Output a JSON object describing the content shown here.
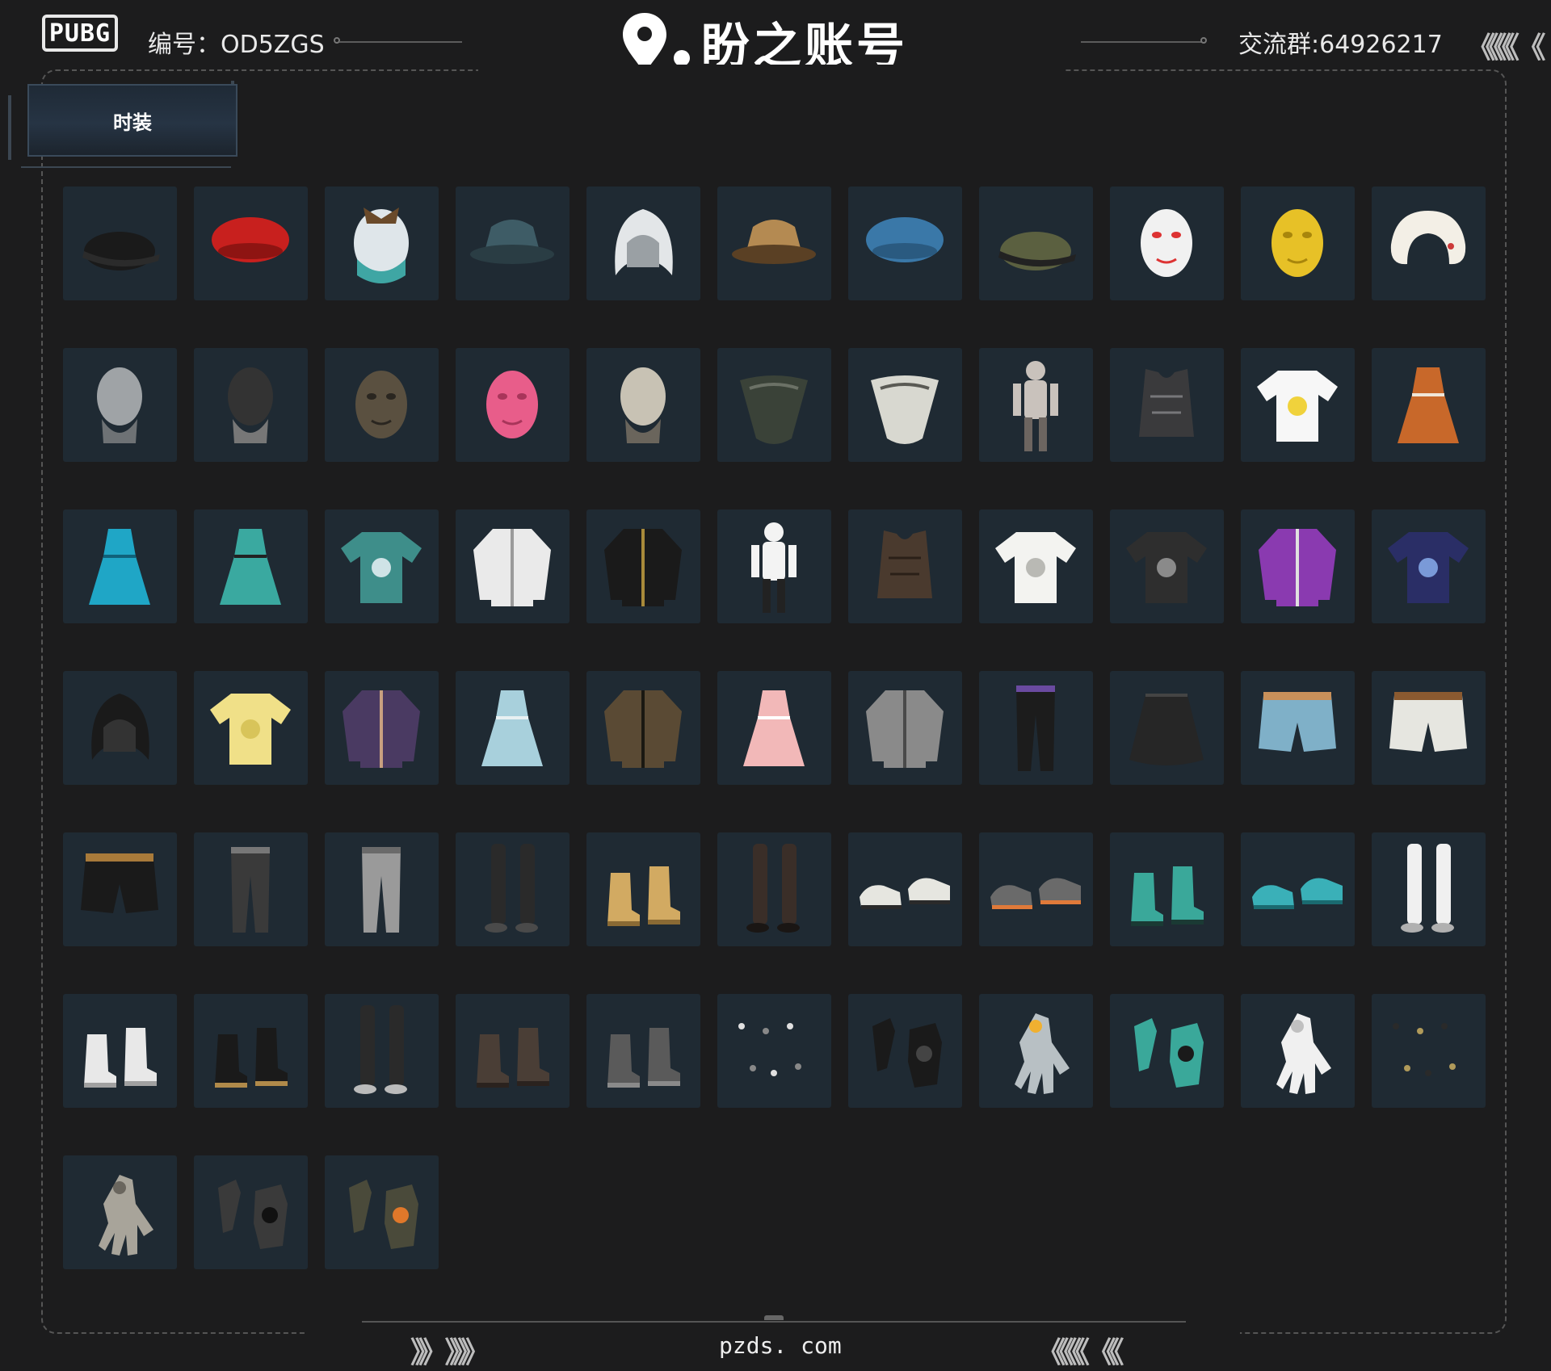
{
  "header": {
    "logo_text": "PUBG",
    "account_label": "编号：OD5ZGS",
    "brand_name": "盼之账号",
    "group_label": "交流群:64926217",
    "right_chevrons": "《《《《 《"
  },
  "tab": {
    "label": "时装"
  },
  "items": [
    {
      "icon": "black-cap-icon",
      "kind": "cap",
      "c1": "#1a1a1a",
      "c2": "#2b2b2b"
    },
    {
      "icon": "red-beret-icon",
      "kind": "beret",
      "c1": "#c8201e",
      "c2": "#8e1412"
    },
    {
      "icon": "fluffy-hat-icon",
      "kind": "fluffy",
      "c1": "#dfe6ea",
      "c2": "#3fa6a4"
    },
    {
      "icon": "bucket-hat-icon",
      "kind": "bucket",
      "c1": "#3e5c66",
      "c2": "#2a3d44"
    },
    {
      "icon": "white-hood-hat-icon",
      "kind": "hood",
      "c1": "#e3e6e8",
      "c2": "#9aa0a4"
    },
    {
      "icon": "leopard-bucket-hat-icon",
      "kind": "bucket",
      "c1": "#b48a52",
      "c2": "#5a4024"
    },
    {
      "icon": "blue-plaid-beret-icon",
      "kind": "beret",
      "c1": "#3a78a8",
      "c2": "#2a5a80"
    },
    {
      "icon": "headset-cap-icon",
      "kind": "cap",
      "c1": "#5b6040",
      "c2": "#222"
    },
    {
      "icon": "chicken-mask-icon",
      "kind": "mask",
      "c1": "#f1f1f1",
      "c2": "#d33"
    },
    {
      "icon": "gold-mask-icon",
      "kind": "mask",
      "c1": "#e7c127",
      "c2": "#a8860c"
    },
    {
      "icon": "neck-pillow-icon",
      "kind": "pillow",
      "c1": "#f3efe6",
      "c2": "#cc3a3a"
    },
    {
      "icon": "bald-head-icon",
      "kind": "head",
      "c1": "#9fa3a6",
      "c2": "#6e7275"
    },
    {
      "icon": "tactical-mask-icon",
      "kind": "head",
      "c1": "#333",
      "c2": "#777"
    },
    {
      "icon": "wolf-mask-icon",
      "kind": "mask",
      "c1": "#5a5040",
      "c2": "#2a2620"
    },
    {
      "icon": "pink-dino-mask-icon",
      "kind": "mask",
      "c1": "#e85d8a",
      "c2": "#a8355a"
    },
    {
      "icon": "skull-mask-icon",
      "kind": "head",
      "c1": "#c8c2b4",
      "c2": "#6a655c"
    },
    {
      "icon": "camo-bandana-icon",
      "kind": "bandana",
      "c1": "#3a4238",
      "c2": "#6b7166"
    },
    {
      "icon": "shemagh-bandana-icon",
      "kind": "bandana",
      "c1": "#d8d8d0",
      "c2": "#5a5a54"
    },
    {
      "icon": "assassin-suit-icon",
      "kind": "figure",
      "c1": "#c9c2bc",
      "c2": "#6c6560"
    },
    {
      "icon": "metal-corset-icon",
      "kind": "vest",
      "c1": "#3a3a3c",
      "c2": "#77777a"
    },
    {
      "icon": "yellow-tshirt-icon",
      "kind": "shirt",
      "c1": "#f7f7f7",
      "c2": "#f0d23c"
    },
    {
      "icon": "tiger-dress-icon",
      "kind": "dress",
      "c1": "#c8682a",
      "c2": "#f0e6d8"
    },
    {
      "icon": "blue-dress-icon",
      "kind": "dress",
      "c1": "#1fa6c6",
      "c2": "#10627a"
    },
    {
      "icon": "teal-dress-icon",
      "kind": "dress",
      "c1": "#3aa9a0",
      "c2": "#222"
    },
    {
      "icon": "hawaiian-shirt-icon",
      "kind": "shirt",
      "c1": "#3e8e8a",
      "c2": "#cfe3e6"
    },
    {
      "icon": "white-uniform-icon",
      "kind": "coat",
      "c1": "#eaeaea",
      "c2": "#9a9a9a"
    },
    {
      "icon": "black-gold-jacket-icon",
      "kind": "coat",
      "c1": "#1a1a1a",
      "c2": "#a88a3a"
    },
    {
      "icon": "dalmatian-suit-icon",
      "kind": "figure",
      "c1": "#f3f3f3",
      "c2": "#222"
    },
    {
      "icon": "leather-vest-icon",
      "kind": "vest",
      "c1": "#4a3a2e",
      "c2": "#2a2018"
    },
    {
      "icon": "white-kungfu-shirt-icon",
      "kind": "shirt",
      "c1": "#f3f3f0",
      "c2": "#b9b9b4"
    },
    {
      "icon": "winner-tshirt-icon",
      "kind": "shirt",
      "c1": "#2e2e2e",
      "c2": "#8a8a8a"
    },
    {
      "icon": "purple-jacket-icon",
      "kind": "coat",
      "c1": "#8a3ab0",
      "c2": "#e0e0e0"
    },
    {
      "icon": "anniversary-sweater-icon",
      "kind": "shirt",
      "c1": "#2a2e66",
      "c2": "#7a9ad8"
    },
    {
      "icon": "black-hood-cloak-icon",
      "kind": "hood",
      "c1": "#1a1a1a",
      "c2": "#333"
    },
    {
      "icon": "yellow-sweater-icon",
      "kind": "shirt",
      "c1": "#f0e088",
      "c2": "#d8c45a"
    },
    {
      "icon": "purple-bomber-jacket-icon",
      "kind": "coat",
      "c1": "#4a3a62",
      "c2": "#c8a080"
    },
    {
      "icon": "nurse-outfit-icon",
      "kind": "dress",
      "c1": "#a8d0dc",
      "c2": "#e8f0f2"
    },
    {
      "icon": "leopard-coat-icon",
      "kind": "coat",
      "c1": "#5a4a34",
      "c2": "#1a1812"
    },
    {
      "icon": "pink-hoodie-icon",
      "kind": "dress",
      "c1": "#f2b8b8",
      "c2": "#fff"
    },
    {
      "icon": "grey-shirt-icon",
      "kind": "coat",
      "c1": "#8a8a8a",
      "c2": "#4a4a4a"
    },
    {
      "icon": "black-trousers-icon",
      "kind": "pants",
      "c1": "#1c1c1c",
      "c2": "#6a4aa0"
    },
    {
      "icon": "black-skirt-icon",
      "kind": "skirt",
      "c1": "#262626",
      "c2": "#444"
    },
    {
      "icon": "denim-shorts-icon",
      "kind": "shorts",
      "c1": "#7fb0c8",
      "c2": "#c8905a"
    },
    {
      "icon": "white-shorts-icon",
      "kind": "shorts",
      "c1": "#e6e6e0",
      "c2": "#8a5a30"
    },
    {
      "icon": "leopard-shorts-icon",
      "kind": "shorts",
      "c1": "#1a1a1a",
      "c2": "#a87a3a"
    },
    {
      "icon": "ripped-jeans-icon",
      "kind": "pants",
      "c1": "#3a3a3a",
      "c2": "#777"
    },
    {
      "icon": "grey-joggers-icon",
      "kind": "pants",
      "c1": "#9a9a9a",
      "c2": "#6a6a6a"
    },
    {
      "icon": "black-thigh-boots-icon",
      "kind": "tallboots",
      "c1": "#2a2a2a",
      "c2": "#4a4a4a"
    },
    {
      "icon": "tan-work-boots-icon",
      "kind": "boots",
      "c1": "#d2aa62",
      "c2": "#8a6a34"
    },
    {
      "icon": "brown-tights-icon",
      "kind": "tallboots",
      "c1": "#3a2e28",
      "c2": "#1a1614"
    },
    {
      "icon": "sandals-icon",
      "kind": "shoes",
      "c1": "#e6e6e0",
      "c2": "#2a2a2a"
    },
    {
      "icon": "grey-sneakers-icon",
      "kind": "shoes",
      "c1": "#6a6a6a",
      "c2": "#e07a3a"
    },
    {
      "icon": "teal-combat-boots-icon",
      "kind": "boots",
      "c1": "#3aa89a",
      "c2": "#1a3a34"
    },
    {
      "icon": "teal-clogs-icon",
      "kind": "shoes",
      "c1": "#3ab0b8",
      "c2": "#1a6a70"
    },
    {
      "icon": "white-tall-boots-icon",
      "kind": "tallboots",
      "c1": "#f0f0f0",
      "c2": "#b0b0b0"
    },
    {
      "icon": "white-slouch-boots-icon",
      "kind": "boots",
      "c1": "#e8e8e8",
      "c2": "#a0a0a0"
    },
    {
      "icon": "leopard-sneakers-icon",
      "kind": "boots",
      "c1": "#1a1a1a",
      "c2": "#b08a4a"
    },
    {
      "icon": "fur-boots-icon",
      "kind": "tallboots",
      "c1": "#2a2a2a",
      "c2": "#bbb"
    },
    {
      "icon": "brown-boots-icon",
      "kind": "boots",
      "c1": "#4a3e36",
      "c2": "#2a221e"
    },
    {
      "icon": "grey-ankle-boots-icon",
      "kind": "boots",
      "c1": "#5a5a5a",
      "c2": "#8a8a8a"
    },
    {
      "icon": "nail-set-icon",
      "kind": "nails",
      "c1": "#e0e0e0",
      "c2": "#888"
    },
    {
      "icon": "black-long-gloves-icon",
      "kind": "gloves",
      "c1": "#1a1a1a",
      "c2": "#444"
    },
    {
      "icon": "flower-bracelet-hand-icon",
      "kind": "hand",
      "c1": "#b8c0c4",
      "c2": "#f0b030"
    },
    {
      "icon": "teal-fingerless-gloves-icon",
      "kind": "gloves",
      "c1": "#3aa89a",
      "c2": "#1a1a1a"
    },
    {
      "icon": "white-gloves-icon",
      "kind": "hand",
      "c1": "#f0f0f0",
      "c2": "#c0c0c0"
    },
    {
      "icon": "accessory-set-icon",
      "kind": "nails",
      "c1": "#2a2a2a",
      "c2": "#b09a5a"
    },
    {
      "icon": "bandaged-gloves-icon",
      "kind": "hand",
      "c1": "#a8a49a",
      "c2": "#6a665e"
    },
    {
      "icon": "black-tactical-gloves-icon",
      "kind": "gloves",
      "c1": "#3a3a3a",
      "c2": "#111"
    },
    {
      "icon": "camo-gloves-icon",
      "kind": "gloves",
      "c1": "#4a4a3a",
      "c2": "#e0782a"
    }
  ],
  "footer": {
    "site": "pzds. com",
    "left_chevrons": "》》 》》》",
    "right_chevrons": "《《《《 《《"
  }
}
